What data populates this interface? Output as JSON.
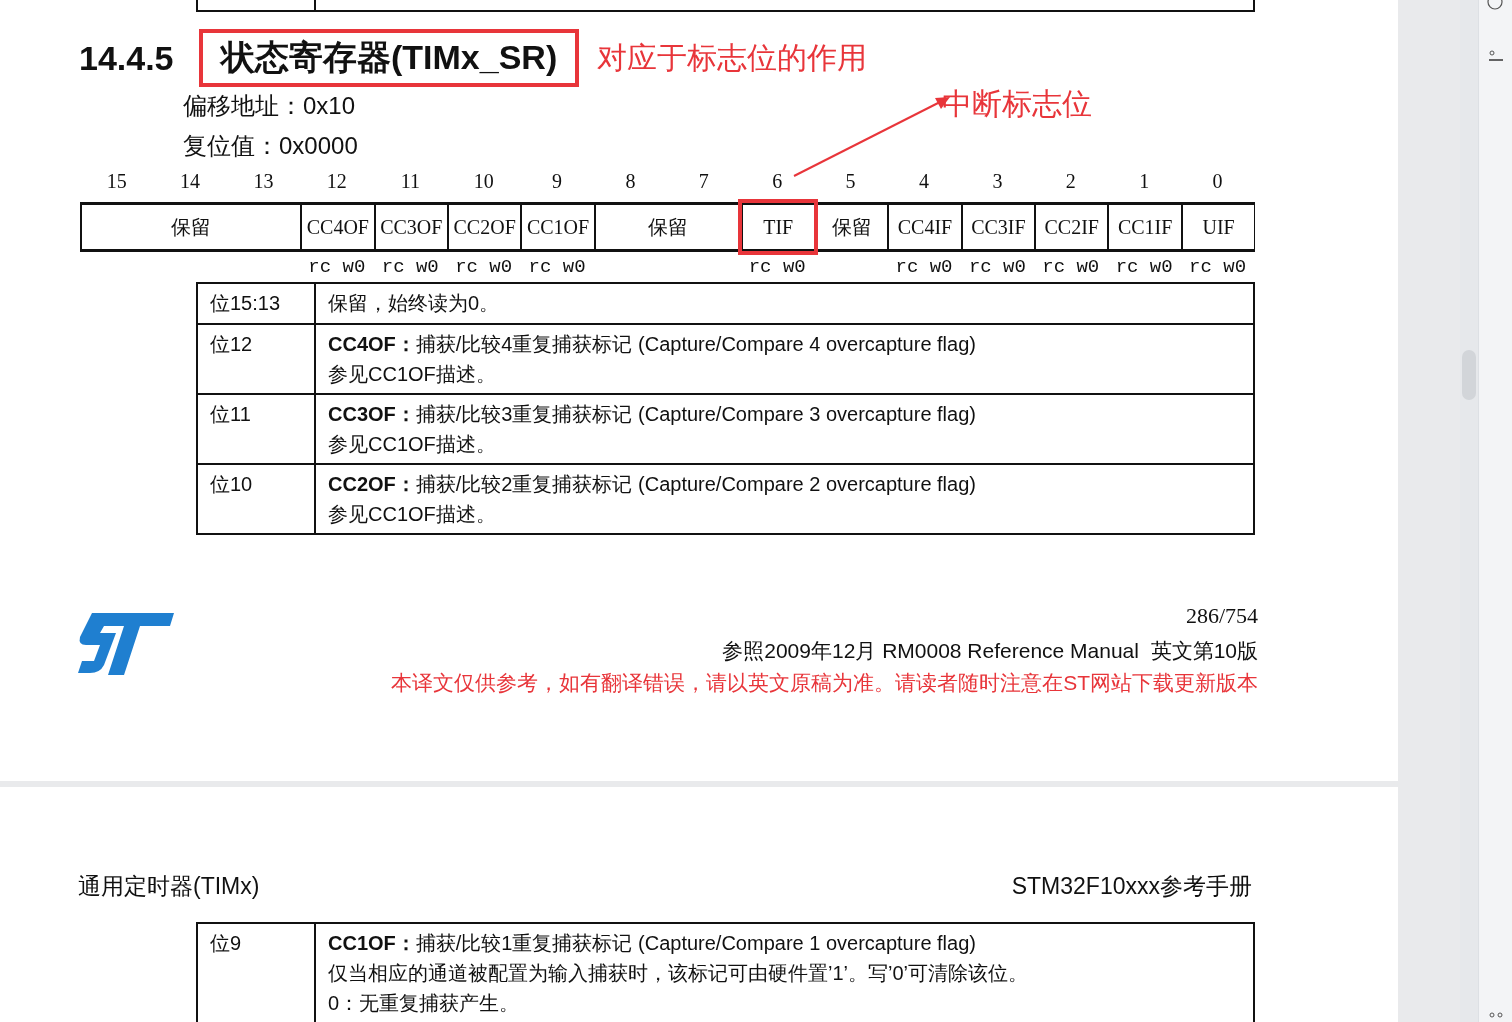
{
  "section": {
    "number": "14.4.5",
    "title": "状态寄存器(TIMx_SR)",
    "title_highlighted": true,
    "annotation": "对应于标志位的作用"
  },
  "offset": "偏移地址：0x10",
  "reset_value": "复位值：0x0000",
  "callout": {
    "text": "中断标志位"
  },
  "register_fields": [
    {
      "bits": [
        "15",
        "14",
        "13"
      ],
      "name": "保留",
      "highlighted": false
    },
    {
      "bits": [
        "12"
      ],
      "name": "CC4OF",
      "access": "rc w0",
      "highlighted": false
    },
    {
      "bits": [
        "11"
      ],
      "name": "CC3OF",
      "access": "rc w0",
      "highlighted": false
    },
    {
      "bits": [
        "10"
      ],
      "name": "CC2OF",
      "access": "rc w0",
      "highlighted": false
    },
    {
      "bits": [
        "9"
      ],
      "name": "CC1OF",
      "access": "rc w0",
      "highlighted": false
    },
    {
      "bits": [
        "8",
        "7"
      ],
      "name": "保留",
      "highlighted": false
    },
    {
      "bits": [
        "6"
      ],
      "name": "TIF",
      "access": "rc w0",
      "highlighted": true
    },
    {
      "bits": [
        "5"
      ],
      "name": "保留",
      "highlighted": false
    },
    {
      "bits": [
        "4"
      ],
      "name": "CC4IF",
      "access": "rc w0",
      "highlighted": false
    },
    {
      "bits": [
        "3"
      ],
      "name": "CC3IF",
      "access": "rc w0",
      "highlighted": false
    },
    {
      "bits": [
        "2"
      ],
      "name": "CC2IF",
      "access": "rc w0",
      "highlighted": false
    },
    {
      "bits": [
        "1"
      ],
      "name": "CC1IF",
      "access": "rc w0",
      "highlighted": false
    },
    {
      "bits": [
        "0"
      ],
      "name": "UIF",
      "access": "rc w0",
      "highlighted": false
    }
  ],
  "bit_table": {
    "rows": [
      {
        "bit": "位15:13",
        "lines": [
          "保留，始终读为0。"
        ]
      },
      {
        "bit": "位12",
        "lines": [
          "**CC4OF：**捕获/比较4重复捕获标记 (Capture/Compare 4 overcapture flag)",
          "参见CC1OF描述。"
        ]
      },
      {
        "bit": "位11",
        "lines": [
          "**CC3OF：**捕获/比较3重复捕获标记 (Capture/Compare 3 overcapture flag)",
          "参见CC1OF描述。"
        ]
      },
      {
        "bit": "位10",
        "lines": [
          "**CC2OF：**捕获/比较2重复捕获标记 (Capture/Compare 2 overcapture flag)",
          "参见CC1OF描述。"
        ]
      }
    ]
  },
  "footer": {
    "page": "286/754",
    "reference": "参照2009年12月 RM0008 Reference Manual  英文第10版",
    "disclaimer": "本译文仅供参考，如有翻译错误，请以英文原稿为准。请读者随时注意在ST网站下载更新版本"
  },
  "next_page": {
    "header_left": "通用定时器(TIMx)",
    "header_right": "STM32F10xxx参考手册",
    "rows": [
      {
        "bit": "位9",
        "lines": [
          "**CC1OF：**捕获/比较1重复捕获标记  (Capture/Compare 1 overcapture flag)",
          "仅当相应的通道被配置为输入捕获时，该标记可由硬件置’1’。写’0’可清除该位。",
          "0：无重复捕获产生。"
        ]
      }
    ]
  }
}
